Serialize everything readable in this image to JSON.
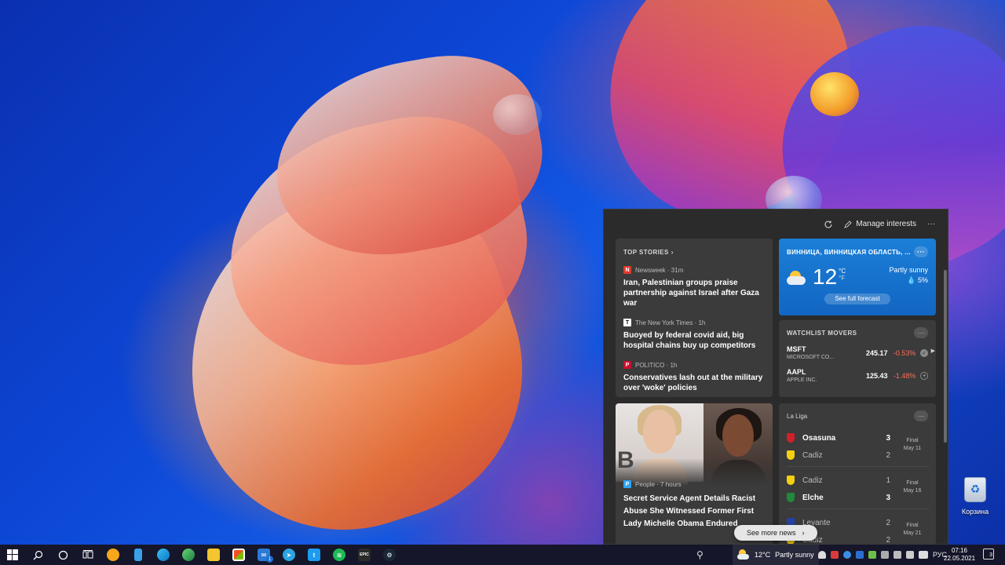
{
  "desktop": {
    "recycle_bin_label": "Корзина"
  },
  "panel": {
    "manage_label": "Manage interests",
    "top_stories": {
      "title": "TOP STORIES",
      "stories": [
        {
          "source": "Newsweek · 31m",
          "logo": "N",
          "logo_color": "#e03a2f",
          "title": "Iran, Palestinian groups praise partnership against Israel after Gaza war"
        },
        {
          "source": "The New York Times · 1h",
          "logo": "T",
          "logo_color": "#ffffff",
          "title": "Buoyed by federal covid aid, big hospital chains buy up competitors"
        },
        {
          "source": "POLITICO · 1h",
          "logo": "P",
          "logo_color": "#c8102e",
          "title": "Conservatives lash out at the military over 'woke' policies"
        }
      ]
    },
    "weather": {
      "location": "ВИННИЦА, ВИННИЦКАЯ ОБЛАСТЬ, ...",
      "temp": "12",
      "unit_c": "°C",
      "unit_f": "°F",
      "condition": "Partly sunny",
      "precip": "5%",
      "forecast_label": "See full forecast"
    },
    "watchlist": {
      "title": "WATCHLIST MOVERS",
      "stocks": [
        {
          "ticker": "MSFT",
          "company": "MICROSOFT CO...",
          "price": "245.17",
          "change": "-0.53%"
        },
        {
          "ticker": "AAPL",
          "company": "APPLE INC.",
          "price": "125.43",
          "change": "-1.48%"
        }
      ]
    },
    "image_story": {
      "letter": "B",
      "source": "People · 7 hours",
      "title": "Secret Service Agent Details Racist Abuse She Witnessed Former First Lady Michelle Obama Endured"
    },
    "laliga": {
      "title": "La Liga",
      "matches": [
        {
          "home": "Osasuna",
          "home_score": "3",
          "away": "Cadiz",
          "away_score": "2",
          "status": "Final",
          "date": "May 11",
          "winner": "home"
        },
        {
          "home": "Cadiz",
          "home_score": "1",
          "away": "Elche",
          "away_score": "3",
          "status": "Final",
          "date": "May 16",
          "winner": "away"
        },
        {
          "home": "Levante",
          "home_score": "2",
          "away": "Cadiz",
          "away_score": "2",
          "status": "Final",
          "date": "May 21",
          "winner": "none"
        }
      ]
    },
    "see_more_label": "See more news"
  },
  "taskbar": {
    "mail_badge": "1",
    "epic_label": "EPIC",
    "weather_temp": "12°C",
    "weather_text": "Partly sunny",
    "language": "РУС",
    "time": "07:16",
    "date": "22.05.2021",
    "notifications": "3"
  },
  "colors": {
    "panel_bg": "#2b2b2b",
    "card_bg": "#3b3b3b",
    "weather_blue": "#1b7fd8",
    "negative": "#ff6b5a",
    "taskbar_bg": "#15162a"
  }
}
